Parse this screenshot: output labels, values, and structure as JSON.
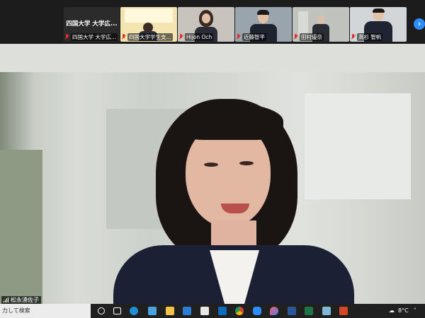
{
  "gallery": {
    "tiles": [
      {
        "center_name": "四国大学 大学広...",
        "label": "四国大学 大学広..."
      },
      {
        "label": "四国大学学生支..."
      },
      {
        "label": "Hijon Och"
      },
      {
        "label": "近藤智平"
      },
      {
        "label": "田村優奈"
      },
      {
        "label": "高杉 智帆"
      }
    ],
    "next_icon": "chevron-right-icon"
  },
  "main_video": {
    "speaker_name": "松永湧佐子"
  },
  "taskbar": {
    "search_text": "力して検索",
    "temperature": "8°C",
    "apps": [
      "cortana-icon",
      "task-view-icon",
      "edge-icon",
      "store-icon",
      "file-explorer-icon",
      "mail-icon",
      "calendar-icon",
      "outlook-icon",
      "chrome-icon",
      "zoom-icon",
      "paint-icon",
      "teams-icon",
      "word-icon",
      "excel-icon",
      "photos-icon",
      "powerpoint-icon"
    ]
  }
}
